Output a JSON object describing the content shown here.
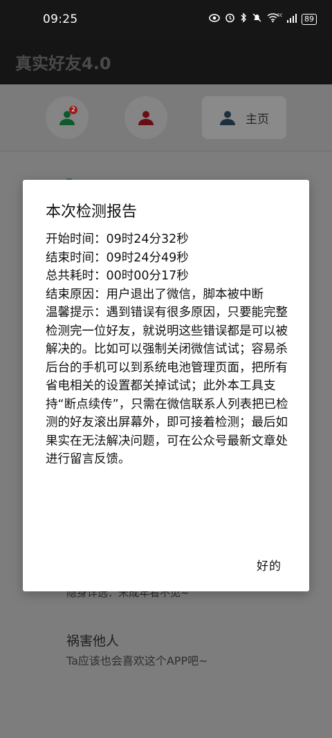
{
  "status_bar": {
    "time": "09:25",
    "battery": "89",
    "icons": [
      "eye-icon",
      "alarm-icon",
      "bluetooth-icon",
      "mute-icon",
      "wifi-5g-icon",
      "signal-icon",
      "battery-icon"
    ]
  },
  "app": {
    "title": "真实好友4.0"
  },
  "tabs": [
    {
      "icon": "person-icon",
      "badge": "2",
      "color": "#0d5a2c"
    },
    {
      "icon": "person-icon",
      "color": "#6a0c14"
    },
    {
      "icon": "person-icon",
      "label": "主页",
      "color": "#1e3040"
    }
  ],
  "background_list": {
    "item_sub": "隐身详选：宋成年看不见~",
    "item_title": "祸害他人",
    "item_desc": "Ta应该也会喜欢这个APP吧~"
  },
  "dialog": {
    "title": "本次检测报告",
    "lines": [
      "开始时间：09时24分32秒",
      "结束时间：09时24分49秒",
      "总共耗时：00时00分17秒",
      "结束原因：用户退出了微信，脚本被中断",
      "温馨提示：遇到错误有很多原因，只要能完整检测完一位好友，就说明这些错误都是可以被解决的。比如可以强制关闭微信试试；容易杀后台的手机可以到系统电池管理页面，把所有省电相关的设置都关掉试试；此外本工具支持“断点续传”，只需在微信联系人列表把已检测的好友滚出屏幕外，即可接着检测；最后如果实在无法解决问题，可在公众号最新文章处进行留言反馈。"
    ],
    "ok_label": "好的"
  }
}
